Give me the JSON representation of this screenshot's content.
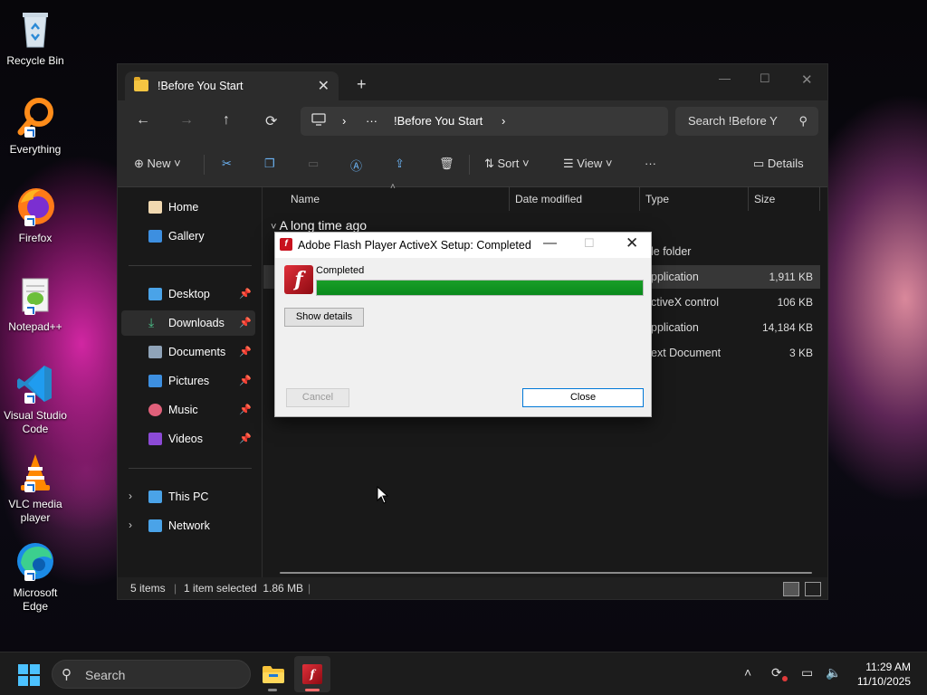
{
  "desktop": {
    "icons": [
      {
        "label": "Recycle Bin"
      },
      {
        "label": "Everything"
      },
      {
        "label": "Firefox"
      },
      {
        "label": "Notepad++"
      },
      {
        "label": "Visual Studio Code"
      },
      {
        "label": "VLC media player"
      },
      {
        "label": "Microsoft Edge"
      }
    ]
  },
  "explorer": {
    "tab_title": "!Before You Start",
    "breadcrumb": {
      "ellipsis": "···",
      "current": "!Before You Start"
    },
    "search_placeholder": "Search !Before Y",
    "commands": {
      "new": "New",
      "sort": "Sort",
      "view": "View",
      "details": "Details",
      "more": "···"
    },
    "sidebar": {
      "home": "Home",
      "gallery": "Gallery",
      "desktop": "Desktop",
      "downloads": "Downloads",
      "documents": "Documents",
      "pictures": "Pictures",
      "music": "Music",
      "videos": "Videos",
      "this_pc": "This PC",
      "network": "Network"
    },
    "columns": {
      "name": "Name",
      "date_modified": "Date modified",
      "type": "Type",
      "size": "Size"
    },
    "group_label": "A long time ago",
    "rows": [
      {
        "type": "le folder",
        "size": ""
      },
      {
        "type": "pplication",
        "size": "1,911 KB"
      },
      {
        "type": "ctiveX control",
        "size": "106 KB"
      },
      {
        "type": "pplication",
        "size": "14,184 KB"
      },
      {
        "type": "ext Document",
        "size": "3 KB"
      }
    ],
    "status": {
      "items": "5 items",
      "selected": "1 item selected  1.86 MB"
    }
  },
  "dialog": {
    "title": "Adobe Flash Player ActiveX Setup: Completed",
    "status_label": "Completed",
    "progress": 1.0,
    "show_details": "Show details",
    "cancel": "Cancel",
    "close": "Close"
  },
  "taskbar": {
    "search": "Search",
    "time": "11:29 AM",
    "date": "11/10/2025"
  },
  "colors": {
    "accent": "#0078d7",
    "progress": "#0a8a1c",
    "flash_red": "#c8121e"
  }
}
